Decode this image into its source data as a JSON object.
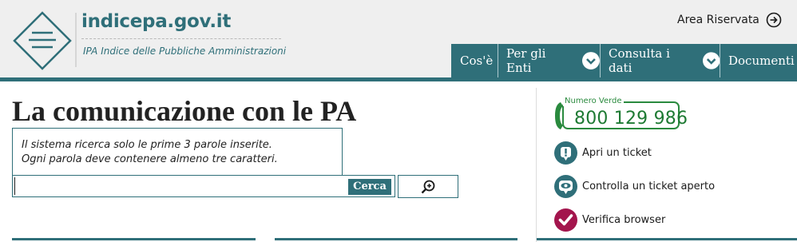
{
  "header": {
    "site_title": "indicepa.gov.it",
    "site_subtitle": "IPA Indice delle Pubbliche Amministrazioni",
    "logo_icon": "menu-diamond-icon",
    "reserved_area_label": "Area Riservata",
    "reserved_area_icon": "arrow-right-circle-icon"
  },
  "nav": {
    "items": [
      {
        "label": "Cos'è",
        "has_dropdown": false
      },
      {
        "label": "Per gli Enti",
        "has_dropdown": true
      },
      {
        "label": "Consulta i dati",
        "has_dropdown": true
      },
      {
        "label": "Documenti",
        "has_dropdown": false
      }
    ]
  },
  "main": {
    "title": "La comunicazione con le PA",
    "hint_lines": [
      "Il sistema ricerca solo le prime 3 parole inserite.",
      "Ogni parola deve contenere almeno tre caratteri."
    ],
    "search": {
      "value": "",
      "placeholder": "",
      "button_label": "Cerca",
      "advanced_icon": "zoom-in-icon"
    }
  },
  "sidebar": {
    "toll_free_label": "Numero Verde",
    "toll_free_number": "800 129 986",
    "links": [
      {
        "label": "Apri un ticket",
        "icon": "exclamation-bubble-icon"
      },
      {
        "label": "Controlla un ticket aperto",
        "icon": "eye-bubble-icon"
      },
      {
        "label": "Verifica browser",
        "icon": "checkmark-icon"
      }
    ]
  },
  "colors": {
    "primary": "#2f6f79",
    "header_bg": "#efefef",
    "toll_free_green": "#2a8a3e",
    "browser_check": "#a3154d"
  }
}
